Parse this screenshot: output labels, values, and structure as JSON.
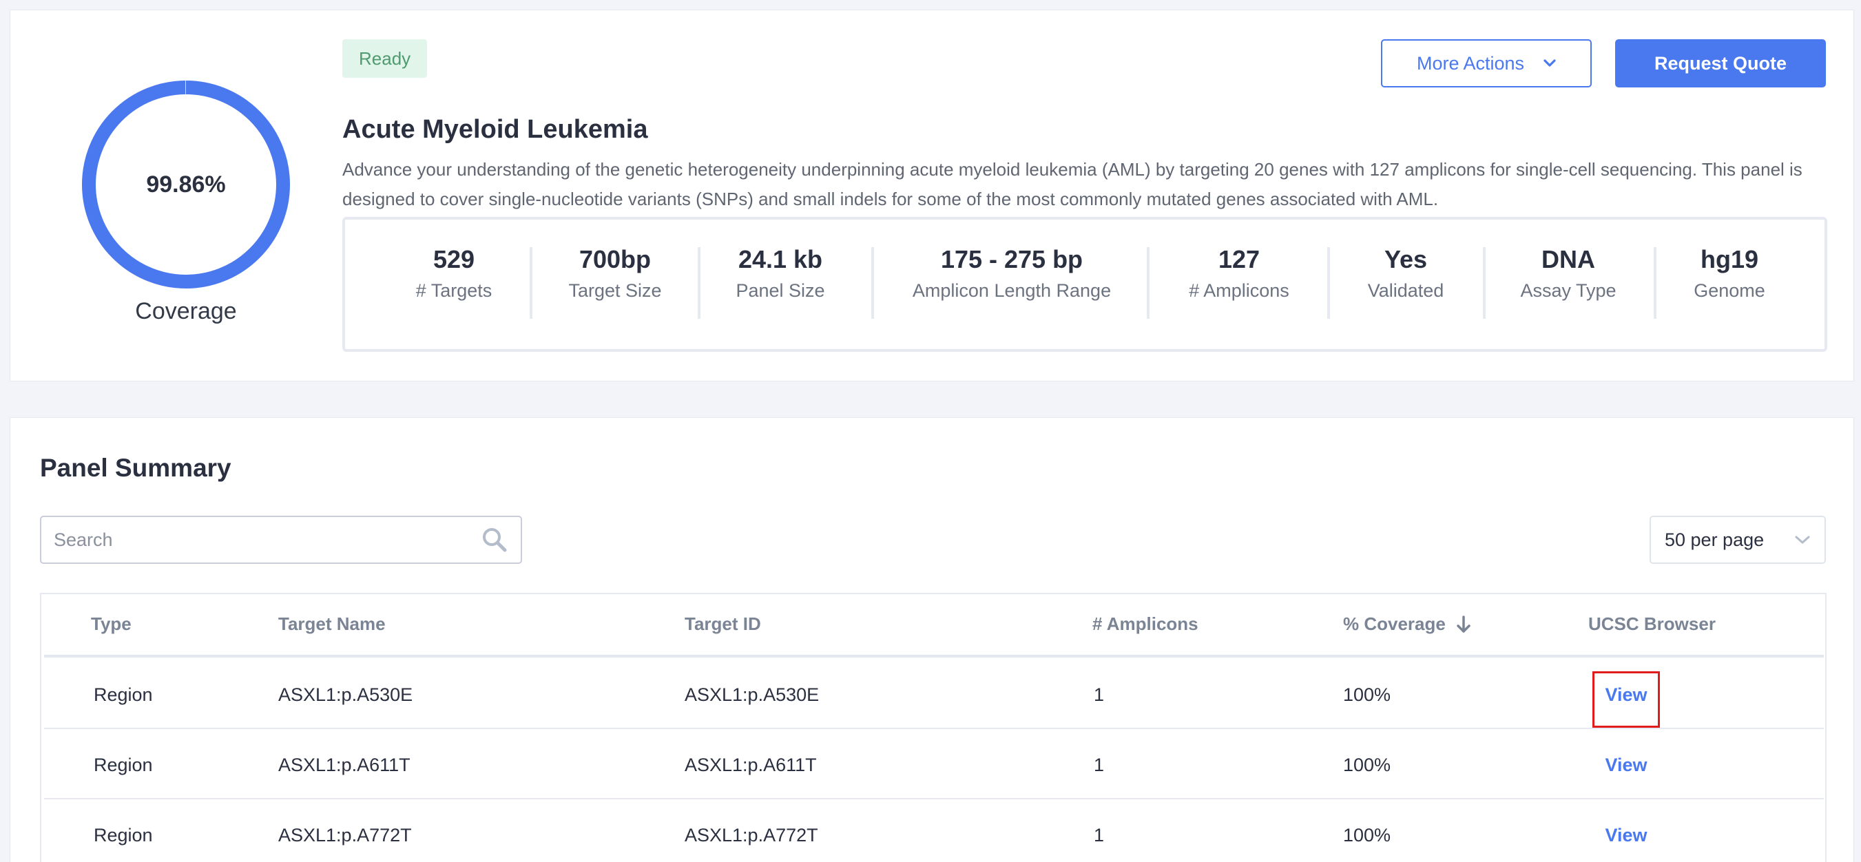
{
  "header": {
    "status_badge": "Ready",
    "title": "Acute Myeloid Leukemia",
    "description": "Advance your understanding of the genetic heterogeneity underpinning acute myeloid leukemia (AML) by targeting 20 genes with 127 amplicons for single-cell sequencing. This panel is designed to cover single-nucleotide variants (SNPs) and small indels for some of the most commonly mutated genes associated with AML.",
    "more_actions_label": "More Actions",
    "request_quote_label": "Request Quote"
  },
  "coverage": {
    "value_text": "99.86%",
    "fraction": 0.9986,
    "label": "Coverage",
    "ring_color": "#4a78ef"
  },
  "stats": [
    {
      "value": "529",
      "label": "# Targets"
    },
    {
      "value": "700bp",
      "label": "Target Size"
    },
    {
      "value": "24.1 kb",
      "label": "Panel Size"
    },
    {
      "value": "175 - 275 bp",
      "label": "Amplicon Length Range"
    },
    {
      "value": "127",
      "label": "# Amplicons"
    },
    {
      "value": "Yes",
      "label": "Validated"
    },
    {
      "value": "DNA",
      "label": "Assay Type"
    },
    {
      "value": "hg19",
      "label": "Genome"
    }
  ],
  "panel_summary": {
    "title": "Panel Summary",
    "search_placeholder": "Search",
    "per_page": "50 per page",
    "columns": [
      "Type",
      "Target Name",
      "Target ID",
      "# Amplicons",
      "% Coverage",
      "UCSC Browser"
    ],
    "sort_indicator_icon": "arrow-down-icon",
    "rows": [
      {
        "type": "Region",
        "target_name": "ASXL1:p.A530E",
        "target_id": "ASXL1:p.A530E",
        "amplicons": "1",
        "coverage": "100%",
        "ucsc": "View"
      },
      {
        "type": "Region",
        "target_name": "ASXL1:p.A611T",
        "target_id": "ASXL1:p.A611T",
        "amplicons": "1",
        "coverage": "100%",
        "ucsc": "View"
      },
      {
        "type": "Region",
        "target_name": "ASXL1:p.A772T",
        "target_id": "ASXL1:p.A772T",
        "amplicons": "1",
        "coverage": "100%",
        "ucsc": "View"
      }
    ]
  },
  "colors": {
    "accent": "#4a78ef",
    "badge_bg": "#e2f5ea",
    "badge_text": "#4f9b6f",
    "highlight_box": "#e01c1c"
  }
}
